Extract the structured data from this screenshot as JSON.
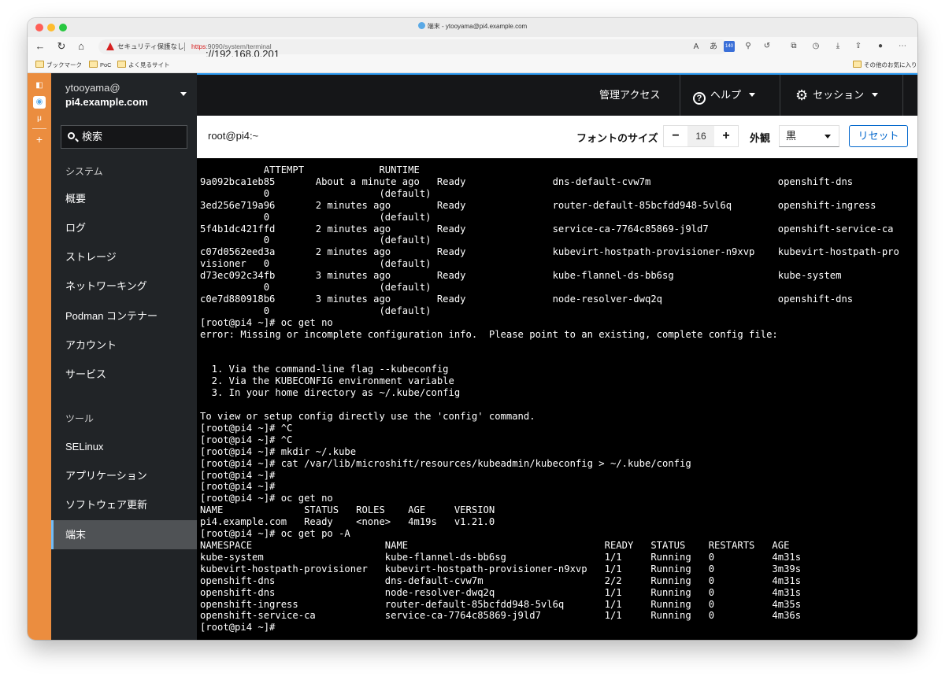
{
  "browser": {
    "tab_title": "端末 - ytooyama@pi4.example.com",
    "security_label": "セキュリティ保護なし",
    "url_scheme": "https",
    "url_host": "://192.168.0.201",
    "url_path": ":9090/system/terminal",
    "bookmarks": [
      "ブックマーク",
      "PoC",
      "よく見るサイト"
    ],
    "other_bookmarks": "その他のお気に入り",
    "extension_badge": "140"
  },
  "nav": {
    "user": "ytooyama@",
    "host": "pi4.example.com",
    "search_label": "検索",
    "section_system": "システム",
    "items": [
      "概要",
      "ログ",
      "ストレージ",
      "ネットワーキング",
      "Podman コンテナー",
      "アカウント",
      "サービス"
    ],
    "section_tools": "ツール",
    "tool_items": [
      "SELinux",
      "アプリケーション",
      "ソフトウェア更新",
      "端末"
    ]
  },
  "masthead": {
    "admin_access": "管理アクセス",
    "help": "ヘルプ",
    "session": "セッション"
  },
  "terminal_header": {
    "title": "root@pi4:~",
    "font_size_label": "フォントのサイズ",
    "font_size_value": "16",
    "minus": "−",
    "plus": "+",
    "appearance_label": "外観",
    "appearance_value": "黒",
    "reset_label": "リセット"
  },
  "terminal": {
    "text": "           ATTEMPT             RUNTIME\n9a092bca1eb85       About a minute ago   Ready               dns-default-cvw7m                      openshift-dns\n           0                   (default)\n3ed256e719a96       2 minutes ago        Ready               router-default-85bcfdd948-5vl6q        openshift-ingress\n           0                   (default)\n5f4b1dc421ffd       2 minutes ago        Ready               service-ca-7764c85869-j9ld7            openshift-service-ca\n           0                   (default)\nc07d0562eed3a       2 minutes ago        Ready               kubevirt-hostpath-provisioner-n9xvp    kubevirt-hostpath-pro\nvisioner   0                   (default)\nd73ec092c34fb       3 minutes ago        Ready               kube-flannel-ds-bb6sg                  kube-system\n           0                   (default)\nc0e7d880918b6       3 minutes ago        Ready               node-resolver-dwq2q                    openshift-dns\n           0                   (default)\n[root@pi4 ~]# oc get no\nerror: Missing or incomplete configuration info.  Please point to an existing, complete config file:\n\n\n  1. Via the command-line flag --kubeconfig\n  2. Via the KUBECONFIG environment variable\n  3. In your home directory as ~/.kube/config\n\nTo view or setup config directly use the 'config' command.\n[root@pi4 ~]# ^C\n[root@pi4 ~]# ^C\n[root@pi4 ~]# mkdir ~/.kube\n[root@pi4 ~]# cat /var/lib/microshift/resources/kubeadmin/kubeconfig > ~/.kube/config\n[root@pi4 ~]#\n[root@pi4 ~]#\n[root@pi4 ~]# oc get no\nNAME              STATUS   ROLES    AGE     VERSION\npi4.example.com   Ready    <none>   4m19s   v1.21.0\n[root@pi4 ~]# oc get po -A\nNAMESPACE                       NAME                                  READY   STATUS    RESTARTS   AGE\nkube-system                     kube-flannel-ds-bb6sg                 1/1     Running   0          4m31s\nkubevirt-hostpath-provisioner   kubevirt-hostpath-provisioner-n9xvp   1/1     Running   0          3m39s\nopenshift-dns                   dns-default-cvw7m                     2/2     Running   0          4m31s\nopenshift-dns                   node-resolver-dwq2q                   1/1     Running   0          4m31s\nopenshift-ingress               router-default-85bcfdd948-5vl6q       1/1     Running   0          4m35s\nopenshift-service-ca            service-ca-7764c85869-j9ld7           1/1     Running   0          4m36s\n[root@pi4 ~]#"
  },
  "colors": {
    "accent_orange": "#eb8d3f",
    "nav_bg": "#212427",
    "masthead_bg": "#151618",
    "link_blue": "#0066cc",
    "active_border": "#73bcf7"
  }
}
